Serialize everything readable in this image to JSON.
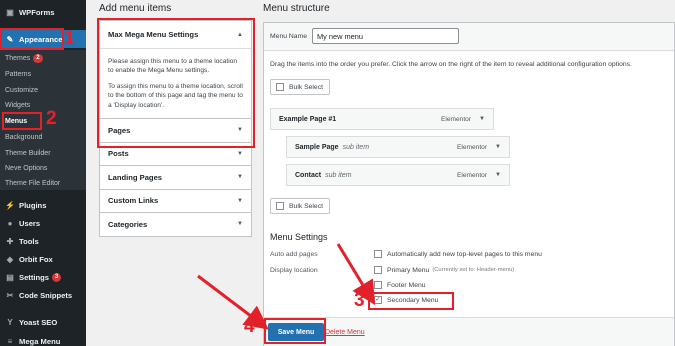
{
  "sidebar": {
    "top_item": {
      "label": "WPForms",
      "icon": "wpforms-icon"
    },
    "appearance": {
      "label": "Appearance",
      "icon": "paintbrush-icon"
    },
    "sub_items": [
      {
        "label": "Themes",
        "badge": "2"
      },
      {
        "label": "Patterns"
      },
      {
        "label": "Customize"
      },
      {
        "label": "Widgets"
      },
      {
        "label": "Menus"
      },
      {
        "label": "Background"
      },
      {
        "label": "Theme Builder"
      },
      {
        "label": "Neve Options"
      },
      {
        "label": "Theme File Editor"
      }
    ],
    "main_items": [
      {
        "label": "Plugins",
        "icon": "plugin-icon"
      },
      {
        "label": "Users",
        "icon": "users-icon"
      },
      {
        "label": "Tools",
        "icon": "wrench-icon"
      },
      {
        "label": "Orbit Fox",
        "icon": "fox-icon"
      },
      {
        "label": "Settings",
        "icon": "settings-icon",
        "badge": "3"
      },
      {
        "label": "Code Snippets",
        "icon": "code-icon"
      },
      {
        "label": "Yoast SEO",
        "icon": "yoast-icon"
      },
      {
        "label": "Mega Menu",
        "icon": "mega-menu-icon"
      }
    ]
  },
  "left_column": {
    "heading": "Add menu items",
    "mega_menu": {
      "title": "Max Mega Menu Settings",
      "para1": "Please assign this menu to a theme location to enable the Mega Menu settings.",
      "para2": "To assign this menu to a theme location, scroll to the bottom of this page and tag the menu to a 'Display location'."
    },
    "sections": [
      "Pages",
      "Posts",
      "Landing Pages",
      "Custom Links",
      "Categories"
    ]
  },
  "menu_structure": {
    "heading": "Menu structure",
    "name_label": "Menu Name",
    "name_value": "My new menu",
    "instructions": "Drag the items into the order you prefer. Click the arrow on the right of the item to reveal additional configuration options.",
    "bulk_select": "Bulk Select",
    "items": [
      {
        "title": "Example Page #1",
        "sub": "",
        "type": "Elementor"
      },
      {
        "title": "Sample Page",
        "sub": "sub item",
        "type": "Elementor"
      },
      {
        "title": "Contact",
        "sub": "sub item",
        "type": "Elementor"
      }
    ],
    "settings": {
      "title": "Menu Settings",
      "auto_add_label": "Auto add pages",
      "auto_add_option": "Automatically add new top-level pages to this menu",
      "display_label": "Display location",
      "locations": [
        {
          "label": "Primary Menu",
          "note": "(Currently set to: Header-menu)",
          "checked": false
        },
        {
          "label": "Footer Menu",
          "note": "",
          "checked": false
        },
        {
          "label": "Secondary Menu",
          "note": "",
          "checked": true
        }
      ]
    },
    "save_button": "Save Menu",
    "delete_link": "Delete Menu"
  },
  "annotations": [
    "1",
    "2",
    "3",
    "4"
  ],
  "colors": {
    "accent": "#2271b1",
    "annotation": "#e3212a",
    "sidebar": "#1d2327"
  }
}
